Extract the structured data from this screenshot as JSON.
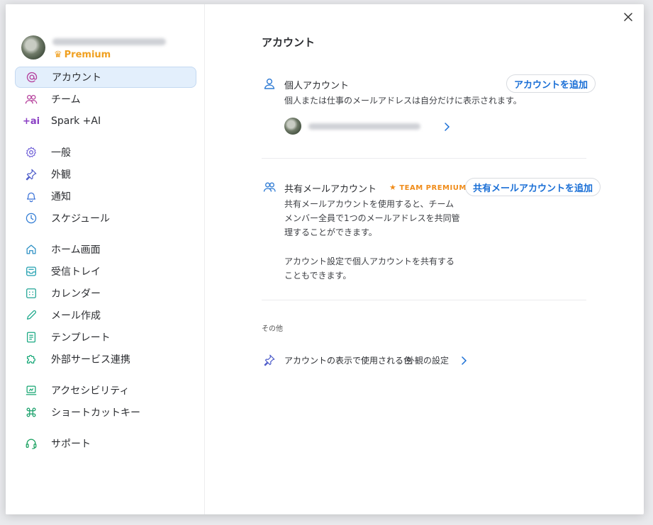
{
  "colors": {
    "accent": "#1a6fd6",
    "premium": "#f0a020",
    "active_bg": "#e3effc",
    "team_premium": "#f08c1a"
  },
  "profile": {
    "badge_label": "Premium"
  },
  "sidebar": {
    "items": [
      {
        "id": "account",
        "label": "アカウント",
        "icon": "at-icon",
        "active": true
      },
      {
        "id": "team",
        "label": "チーム",
        "icon": "team-icon"
      },
      {
        "id": "spark-ai",
        "label": "Spark +AI",
        "icon": "ai-icon",
        "icon_text": "+ai"
      },
      {
        "id": "general",
        "label": "一般",
        "icon": "gear-icon"
      },
      {
        "id": "appearance",
        "label": "外観",
        "icon": "pin-icon"
      },
      {
        "id": "notifications",
        "label": "通知",
        "icon": "bell-icon"
      },
      {
        "id": "schedule",
        "label": "スケジュール",
        "icon": "clock-icon"
      },
      {
        "id": "home",
        "label": "ホーム画面",
        "icon": "home-icon"
      },
      {
        "id": "inbox",
        "label": "受信トレイ",
        "icon": "inbox-icon"
      },
      {
        "id": "calendar",
        "label": "カレンダー",
        "icon": "calendar-icon"
      },
      {
        "id": "compose",
        "label": "メール作成",
        "icon": "pencil-icon"
      },
      {
        "id": "templates",
        "label": "テンプレート",
        "icon": "template-icon"
      },
      {
        "id": "integrations",
        "label": "外部サービス連携",
        "icon": "puzzle-icon"
      },
      {
        "id": "accessibility",
        "label": "アクセシビリティ",
        "icon": "accessibility-icon"
      },
      {
        "id": "shortcuts",
        "label": "ショートカットキー",
        "icon": "command-icon"
      },
      {
        "id": "support",
        "label": "サポート",
        "icon": "headset-icon"
      }
    ]
  },
  "main": {
    "title": "アカウント",
    "personal": {
      "title": "個人アカウント",
      "add_button": "アカウントを追加",
      "description": "個人または仕事のメールアドレスは自分だけに表示されます。"
    },
    "shared": {
      "title": "共有メールアカウント",
      "badge": "TEAM PREMIUM",
      "add_button": "共有メールアカウントを追加",
      "description1": "共有メールアカウントを使用すると、チームメンバー全員で1つのメールアドレスを共同管理することができます。",
      "description2": "アカウント設定で個人アカウントを共有することもできます。"
    },
    "other": {
      "label": "その他",
      "color_row_text": "アカウントの表示で使用される色",
      "color_row_link": "外観の設定"
    }
  }
}
